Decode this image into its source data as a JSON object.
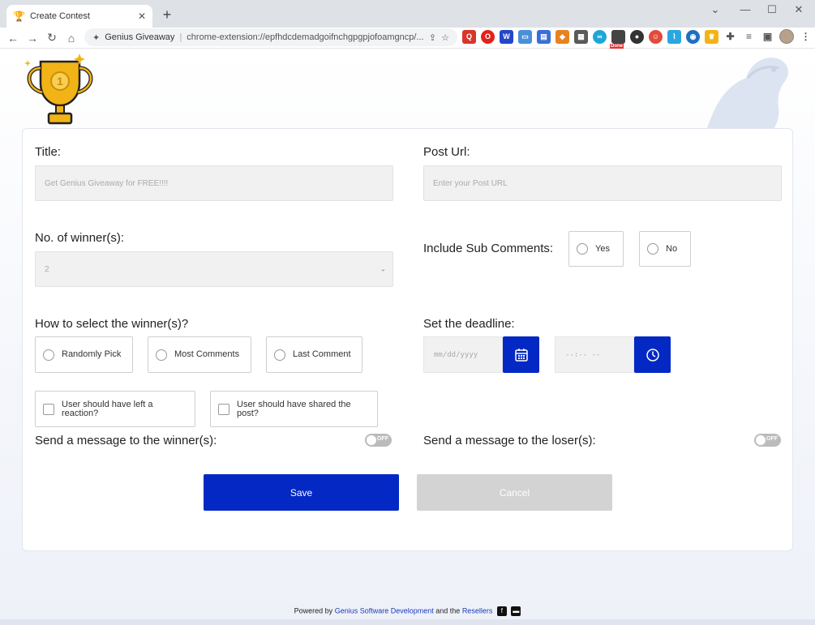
{
  "browser": {
    "tab_title": "Create Contest",
    "tab_close": "✕",
    "new_tab": "+",
    "site_name": "Genius Giveaway",
    "url": "chrome-extension://epfhdcdemadgoifnchgpgpjofoamgncp/...",
    "ext_done_badge": "Done"
  },
  "form": {
    "title_label": "Title:",
    "title_value": "Get Genius Giveaway for FREE!!!!",
    "post_url_label": "Post Url:",
    "post_url_placeholder": "Enter your Post URL",
    "winners_label": "No. of winner(s):",
    "winners_value": "2",
    "sub_comments_label": "Include Sub Comments:",
    "sub_yes": "Yes",
    "sub_no": "No",
    "select_label": "How to select the winner(s)?",
    "select_options": [
      "Randomly Pick",
      "Most Comments",
      "Last Comment"
    ],
    "conditions": [
      "User should have left a reaction?",
      "User should have shared the post?"
    ],
    "deadline_label": "Set the deadline:",
    "date_placeholder": "mm/dd/yyyy",
    "time_placeholder": "--:-- --",
    "winner_msg_label": "Send a message to the winner(s):",
    "loser_msg_label": "Send a message to the loser(s):",
    "toggle_off": "OFF",
    "save_label": "Save",
    "cancel_label": "Cancel"
  },
  "footer": {
    "prefix": "Powered by",
    "company": "Genius Software Development",
    "middle": "and the",
    "resellers": "Resellers"
  },
  "colors": {
    "accent": "#0328c4",
    "trophy": "#f2b316",
    "cancel": "#d3d3d3"
  }
}
